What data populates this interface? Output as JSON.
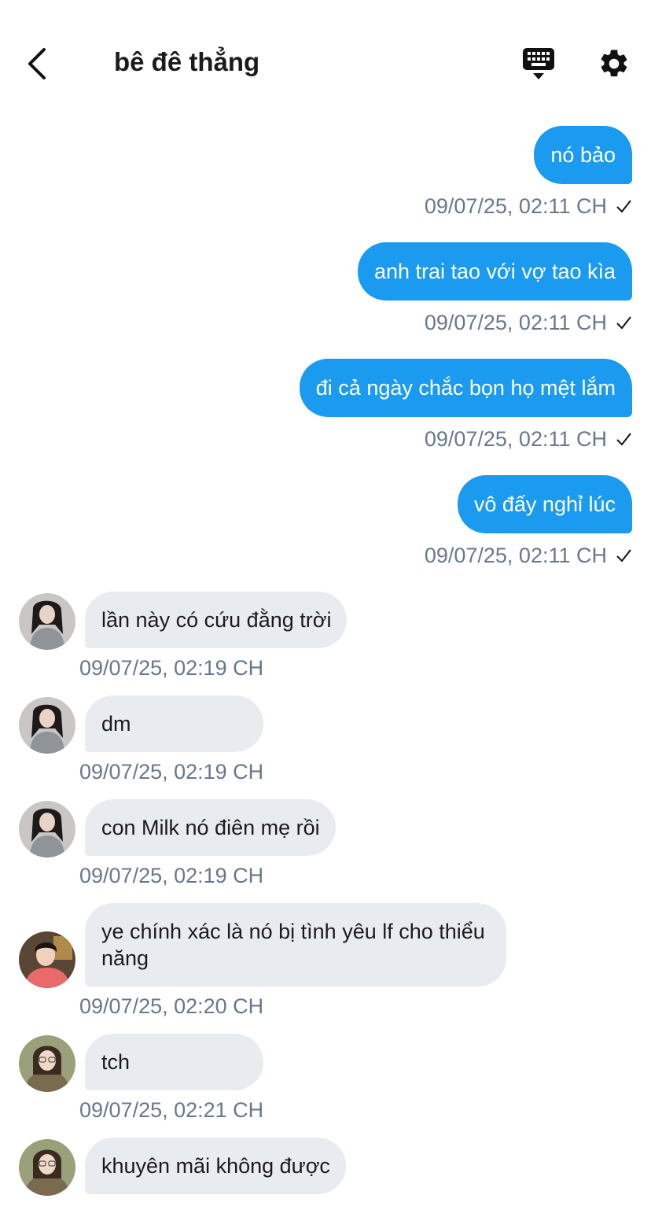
{
  "header": {
    "title": "bê đê thẳng",
    "back_icon": "chevron-left-icon",
    "keyboard_icon": "keyboard-hide-icon",
    "settings_icon": "gear-icon"
  },
  "colors": {
    "accent": "#1a9bf0",
    "incoming_bubble": "#e8ecf0",
    "timestamp": "#68788c"
  },
  "messages": [
    {
      "direction": "out",
      "text": "nó bảo",
      "time": "09/07/25, 02:11 CH",
      "status": "sent-check"
    },
    {
      "direction": "out",
      "text": "anh trai tao với vợ tao kìa",
      "time": "09/07/25, 02:11 CH",
      "status": "sent-check"
    },
    {
      "direction": "out",
      "text": "đi cả ngày chắc bọn họ mệt lắm",
      "time": "09/07/25, 02:11 CH",
      "status": "sent-check"
    },
    {
      "direction": "out",
      "text": "vô đấy nghỉ lúc",
      "time": "09/07/25, 02:11 CH",
      "status": "sent-check"
    },
    {
      "direction": "in",
      "sender": "avatar-1",
      "text": "lần này có cứu đằng trời",
      "time": "09/07/25, 02:19 CH"
    },
    {
      "direction": "in",
      "sender": "avatar-1",
      "text": "dm",
      "time": "09/07/25, 02:19 CH"
    },
    {
      "direction": "in",
      "sender": "avatar-1",
      "text": "con Milk nó điên mẹ rồi",
      "time": "09/07/25, 02:19 CH"
    },
    {
      "direction": "in",
      "sender": "avatar-2",
      "text": "ye chính xác là nó bị tình yêu lf cho thiểu năng",
      "time": "09/07/25, 02:20 CH"
    },
    {
      "direction": "in",
      "sender": "avatar-3",
      "text": "tch",
      "time": "09/07/25, 02:21 CH"
    },
    {
      "direction": "in",
      "sender": "avatar-3",
      "text": "khuyên mãi không được",
      "time": ""
    }
  ]
}
